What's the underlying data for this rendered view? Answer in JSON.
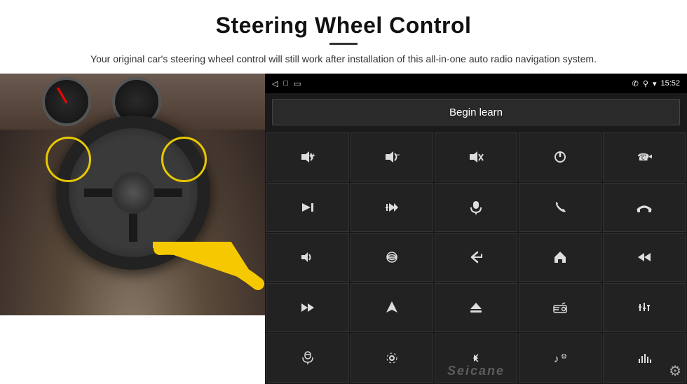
{
  "page": {
    "title": "Steering Wheel Control",
    "divider": true,
    "subtitle": "Your original car's steering wheel control will still work after installation of this all-in-one auto radio navigation system."
  },
  "status_bar": {
    "back_icon": "◁",
    "home_icon": "□",
    "recent_icon": "▭",
    "battery_icon": "▪▪",
    "phone_icon": "✆",
    "location_icon": "⚲",
    "wifi_icon": "▾",
    "time": "15:52"
  },
  "screen": {
    "begin_learn_label": "Begin learn",
    "seicane_label": "Seicane"
  },
  "controls": [
    {
      "id": "vol-up",
      "icon": "🔊+",
      "unicode": "🔊"
    },
    {
      "id": "vol-down",
      "icon": "🔉−",
      "unicode": "🔉"
    },
    {
      "id": "mute",
      "icon": "🔇×",
      "unicode": "🔇"
    },
    {
      "id": "power",
      "icon": "⏻",
      "unicode": "⏻"
    },
    {
      "id": "prev-track2",
      "icon": "⏮",
      "unicode": "⏮"
    },
    {
      "id": "next-track",
      "icon": "⏭",
      "unicode": "⏭"
    },
    {
      "id": "ff-prev",
      "icon": "⏪×",
      "unicode": "⏪"
    },
    {
      "id": "mic",
      "icon": "🎤",
      "unicode": "🎤"
    },
    {
      "id": "phone",
      "icon": "📞",
      "unicode": "📞"
    },
    {
      "id": "hang-up",
      "icon": "↩",
      "unicode": "↩"
    },
    {
      "id": "horn",
      "icon": "📢",
      "unicode": "📢"
    },
    {
      "id": "360-cam",
      "icon": "360",
      "unicode": "360"
    },
    {
      "id": "back",
      "icon": "↩",
      "unicode": "↩"
    },
    {
      "id": "home",
      "icon": "⌂",
      "unicode": "⌂"
    },
    {
      "id": "prev-track3",
      "icon": "⏮",
      "unicode": "⏮"
    },
    {
      "id": "fast-fwd",
      "icon": "⏭",
      "unicode": "⏭"
    },
    {
      "id": "navi",
      "icon": "▶",
      "unicode": "▶"
    },
    {
      "id": "eject",
      "icon": "⏏",
      "unicode": "⏏"
    },
    {
      "id": "radio",
      "icon": "📻",
      "unicode": "📻"
    },
    {
      "id": "equalizer",
      "icon": "⚙",
      "unicode": "⚙"
    },
    {
      "id": "mic2",
      "icon": "🎤",
      "unicode": "🎤"
    },
    {
      "id": "settings2",
      "icon": "⚙",
      "unicode": "⚙"
    },
    {
      "id": "bluetooth",
      "icon": "⚡",
      "unicode": "⚡"
    },
    {
      "id": "music",
      "icon": "♪",
      "unicode": "♪"
    },
    {
      "id": "equalizer2",
      "icon": "≡",
      "unicode": "≡"
    }
  ],
  "icons_unicode": {
    "vol_up": "◁+",
    "vol_down": "◁−",
    "mute": "◁×",
    "power": "○",
    "phone_call": "☎",
    "skip_prev": "⏮",
    "skip_next": "⏭",
    "fast_forward": "⏩",
    "microphone": "♦",
    "phone_answer": "☎",
    "hang_up": "⌒",
    "speaker": "◈",
    "camera_360": "◎",
    "back_nav": "↩",
    "home_nav": "⌂",
    "rewind": "⏪",
    "navigate": "►",
    "eject": "⏏",
    "radio": "◫",
    "eq": "≎",
    "mic3": "♠",
    "clock": "◉",
    "bt": "ᛒ",
    "music_note": "♫",
    "bars": "⋮"
  },
  "gear": "⚙"
}
